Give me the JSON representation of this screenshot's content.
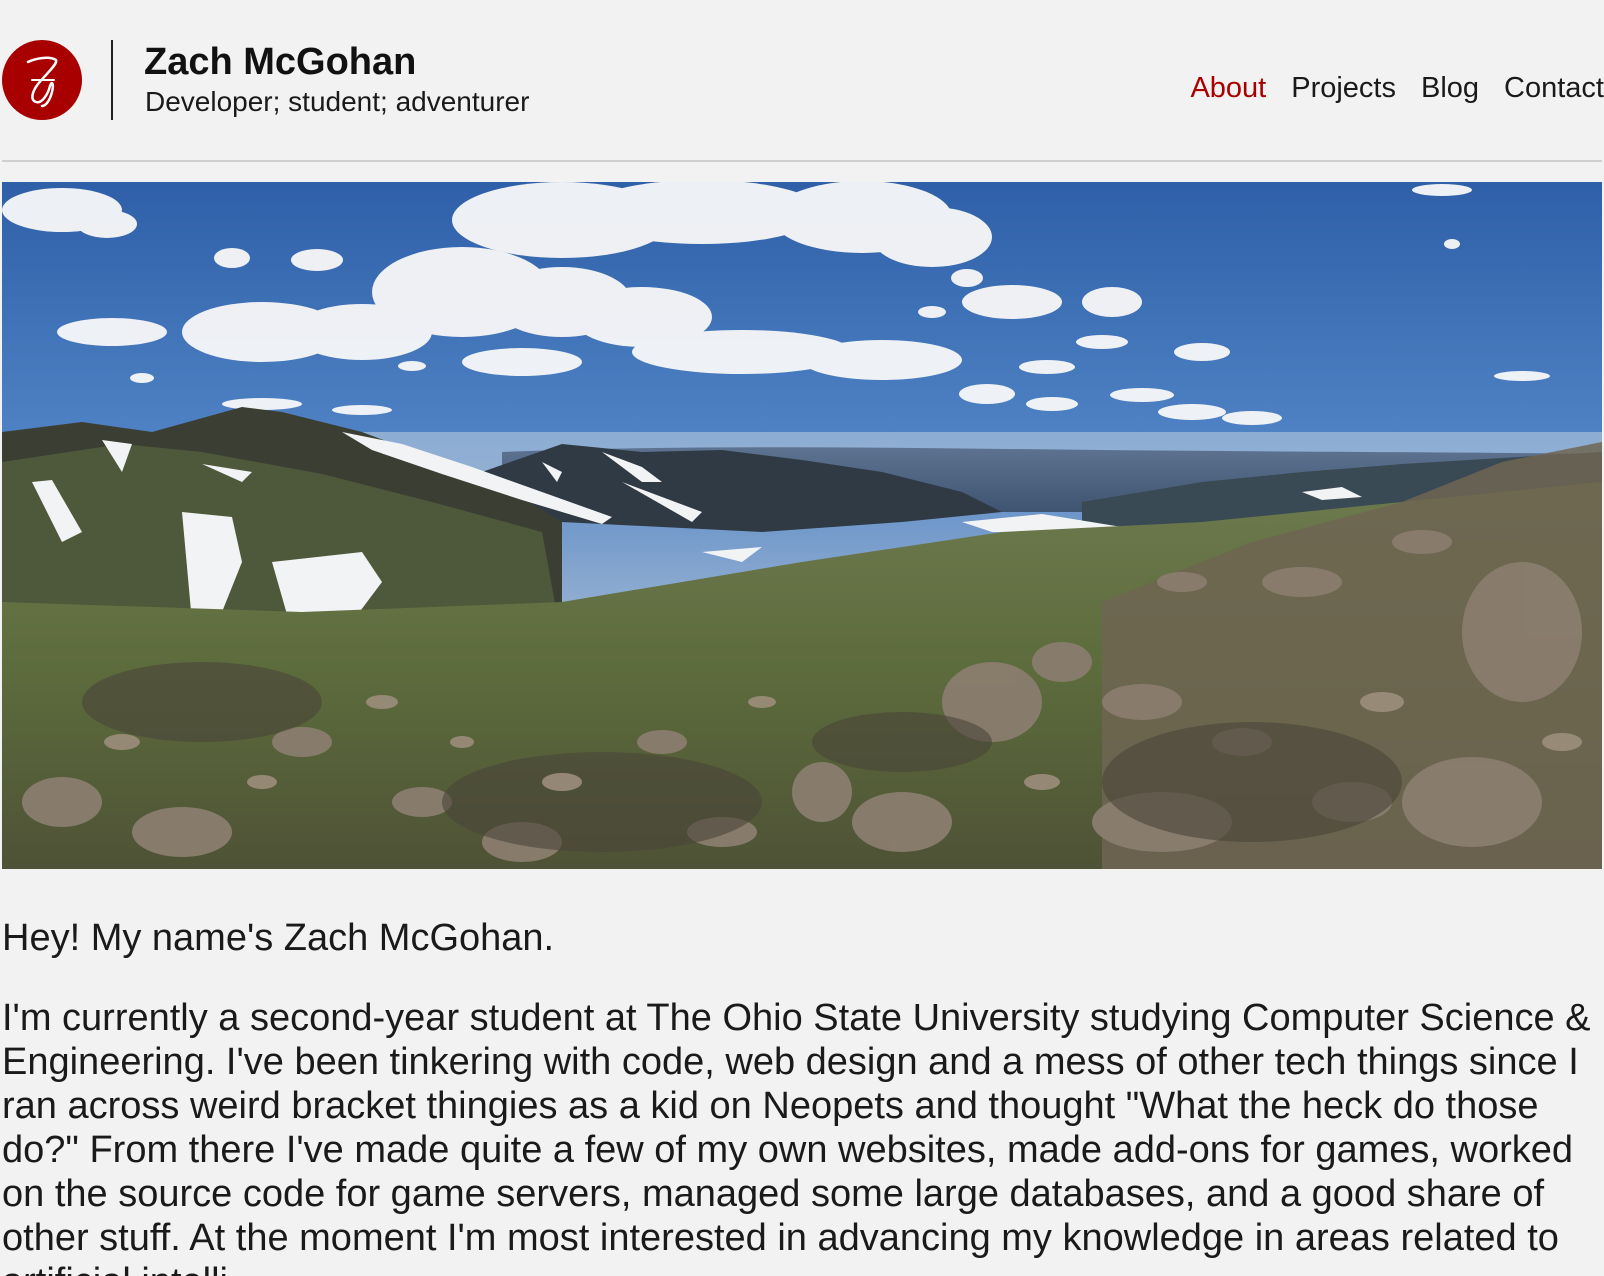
{
  "header": {
    "logo_letter": "Z",
    "title": "Zach McGohan",
    "tagline": "Developer; student; adventurer"
  },
  "nav": {
    "items": [
      "About",
      "Projects",
      "Blog",
      "Contact"
    ],
    "active": "About"
  },
  "colors": {
    "accent": "#a80000",
    "background": "#f2f2f2",
    "text": "#1a1a1a",
    "rule": "#cfcfcf"
  },
  "hero": {
    "icon": "mountain-panorama-photo"
  },
  "content": {
    "greeting": "Hey! My name's Zach McGohan.",
    "about": "I'm currently a second-year student at The Ohio State University studying Computer Science & Engineering. I've been tinkering with code, web design and a mess of other tech things since I ran across weird bracket thingies as a kid on Neopets and thought \"What the heck do those do?\" From there I've made quite a few of my own websites, made add-ons for games, worked on the source code for game servers, managed some large databases, and a good share of other stuff. At the moment I'm most interested in advancing my knowledge in areas related to artificial intelli"
  }
}
